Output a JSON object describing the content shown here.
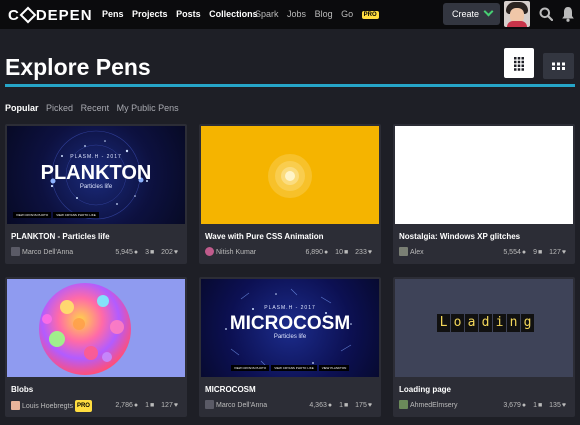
{
  "header": {
    "logo": "C DEPEN",
    "nav_primary": [
      "Pens",
      "Projects",
      "Posts",
      "Collections"
    ],
    "nav_secondary": [
      "Spark",
      "Jobs",
      "Blog",
      "Go"
    ],
    "pro_badge": "PRO",
    "create_label": "Create"
  },
  "page": {
    "title": "Explore Pens",
    "tabs": [
      "Popular",
      "Picked",
      "Recent",
      "My Public Pens"
    ],
    "active_tab": "Popular"
  },
  "cards": [
    {
      "title": "PLANKTON - Particles life",
      "author": "Marco Dell'Anna",
      "views": "5,945",
      "comments": "3",
      "loves": "202",
      "thumb": {
        "kicker": "PLASM.H - 2017",
        "heading": "PLANKTON",
        "sub": "Particles life",
        "buttons": [
          "VIEW CRYANS PHOTO",
          "VIEW CRYANS PHOTO LIKE"
        ]
      }
    },
    {
      "title": "Wave with Pure CSS Animation",
      "author": "Nitish Kumar",
      "views": "6,890",
      "comments": "10",
      "loves": "233"
    },
    {
      "title": "Nostalgia: Windows XP glitches",
      "author": "Alex",
      "views": "5,554",
      "comments": "9",
      "loves": "127"
    },
    {
      "title": "Blobs",
      "author": "Louis Hoebregts",
      "author_badge": "PRO",
      "views": "2,786",
      "comments": "1",
      "loves": "127"
    },
    {
      "title": "MICROCOSM",
      "author": "Marco Dell'Anna",
      "views": "4,363",
      "comments": "1",
      "loves": "175",
      "thumb": {
        "kicker": "PLASM.H - 2017",
        "heading": "MICROCOSM",
        "sub": "Particles life",
        "buttons": [
          "VIEW CRYANS PHOTO",
          "VIEW CRYANS PHOTO LIKE",
          "VIEW PLANKTON"
        ]
      }
    },
    {
      "title": "Loading page",
      "author": "AhmedElmsery",
      "views": "3,679",
      "comments": "1",
      "loves": "135",
      "thumb": {
        "letters": [
          "L",
          "o",
          "a",
          "d",
          "i",
          "n",
          "g"
        ]
      }
    }
  ],
  "colors": {
    "accent_rule": "#26a5c8",
    "create_chevron": "#47cf73",
    "wave_bg": "#f5b400",
    "card_bg": "#2c2d36"
  }
}
